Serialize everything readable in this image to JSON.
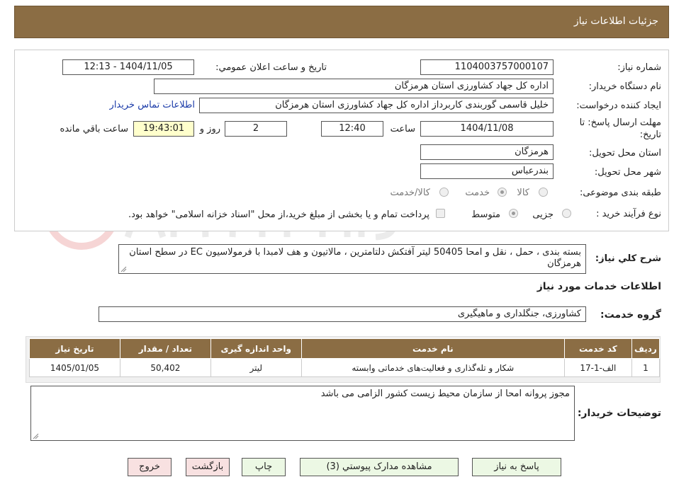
{
  "header": {
    "title": "جزئیات اطلاعات نیاز"
  },
  "form": {
    "need_number_label": "شماره نیاز:",
    "need_number": "1104003757000107",
    "announce_label": "تاریخ و ساعت اعلان عمومي:",
    "announce_value": "1404/11/05 - 12:13",
    "buyer_org_label": "نام دستگاه خریدار:",
    "buyer_org": "اداره کل جهاد کشاورزی استان هرمزگان",
    "creator_label": "ایجاد کننده درخواست:",
    "creator": "خلیل قاسمی گوربندی کاربرداز اداره کل جهاد کشاورزی استان هرمزگان",
    "contact_link": "اطلاعات تماس خریدار",
    "deadline_label": "مهلت ارسال پاسخ: تا تاریخ:",
    "deadline_date": "1404/11/08",
    "time_word": "ساعت",
    "deadline_time": "12:40",
    "days_value": "2",
    "days_word": "روز و",
    "remaining_time": "19:43:01",
    "remaining_word": "ساعت باقي مانده",
    "province_label": "استان محل تحویل:",
    "province": "هرمزگان",
    "city_label": "شهر محل تحویل:",
    "city": "بندرعباس",
    "category_label": "طبقه بندی موضوعی:",
    "category_options": [
      "کالا",
      "خدمت",
      "کالا/خدمت"
    ],
    "category_selected": "خدمت",
    "process_label": "نوع فرآیند خرید :",
    "process_options": [
      "جزیی",
      "متوسط"
    ],
    "process_selected": "متوسط",
    "payment_note": "پرداخت تمام و یا بخشی از مبلغ خرید،از محل \"اسناد خزانه اسلامی\" خواهد بود.",
    "description_label": "شرح کلي نیاز:",
    "description": "بسته بندی ، حمل ، نقل و امحا 50405 لیتر آفتکش دلتامترین ، مالاتیون و هف لامبدا با فرمولاسیون EC در سطح استان هرمزگان"
  },
  "services": {
    "section_title": "اطلاعات خدمات مورد نیاز",
    "group_label": "گروه خدمت:",
    "group_value": "کشاورزی، جنگلداری و ماهیگیری",
    "columns": [
      "ردیف",
      "کد خدمت",
      "نام خدمت",
      "واحد اندازه گیری",
      "تعداد / مقدار",
      "تاریخ نیاز"
    ],
    "rows": [
      [
        "1",
        "الف-1-17",
        "شکار و تله‌گذاری و فعالیت‌های خدماتی وابسته",
        "لیتر",
        "50,402",
        "1405/01/05"
      ]
    ]
  },
  "buyer_notes": {
    "label": "توضیحات خریدار:",
    "text": "مجوز پروانه امحا از سازمان محیط زیست کشور الزامی می باشد"
  },
  "buttons": {
    "reply": "پاسخ به نیاز",
    "attachments": "مشاهده مدارک پیوستي (3)",
    "print": "چاپ",
    "back": "بازگشت",
    "exit": "خروج"
  },
  "colors": {
    "header_bg": "#8b6d44",
    "button_bg": "#ecf8e4",
    "button_red_bg": "#f8e1e1",
    "link": "#1a3aa8",
    "highlight": "#ffffcc"
  }
}
